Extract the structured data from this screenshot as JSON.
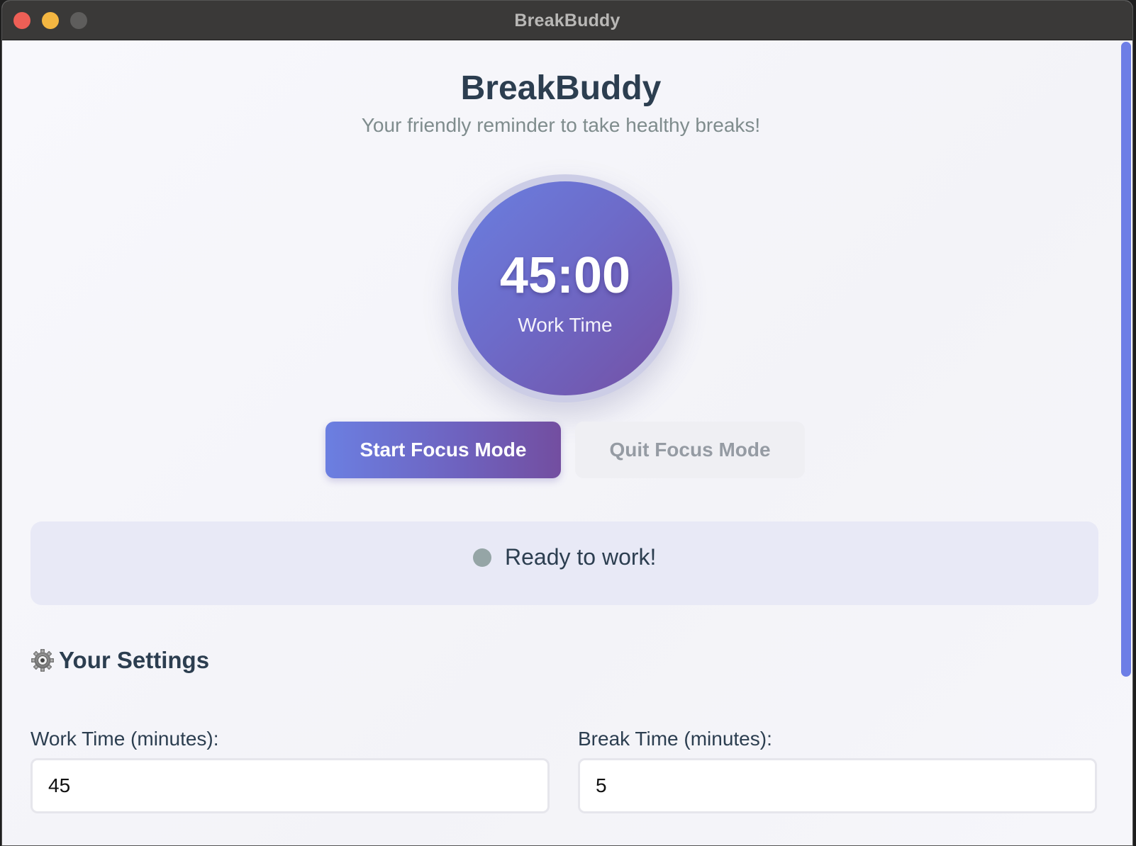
{
  "window": {
    "title": "BreakBuddy"
  },
  "header": {
    "title": "BreakBuddy",
    "subtitle": "Your friendly reminder to take healthy breaks!"
  },
  "timer": {
    "time": "45:00",
    "mode_label": "Work Time"
  },
  "controls": {
    "start_label": "Start Focus Mode",
    "quit_label": "Quit Focus Mode"
  },
  "status": {
    "text": "Ready to work!",
    "indicator_color": "#95a5a6"
  },
  "settings": {
    "heading": "Your Settings",
    "heading_icon": "gear-icon",
    "work_time_label": "Work Time (minutes):",
    "work_time_value": "45",
    "break_time_label": "Break Time (minutes):",
    "break_time_value": "5"
  },
  "theme": {
    "accent_start": "#6a7fe0",
    "accent_end": "#7450a4",
    "text_dark": "#2c3e50",
    "text_muted": "#7f8c8d"
  }
}
